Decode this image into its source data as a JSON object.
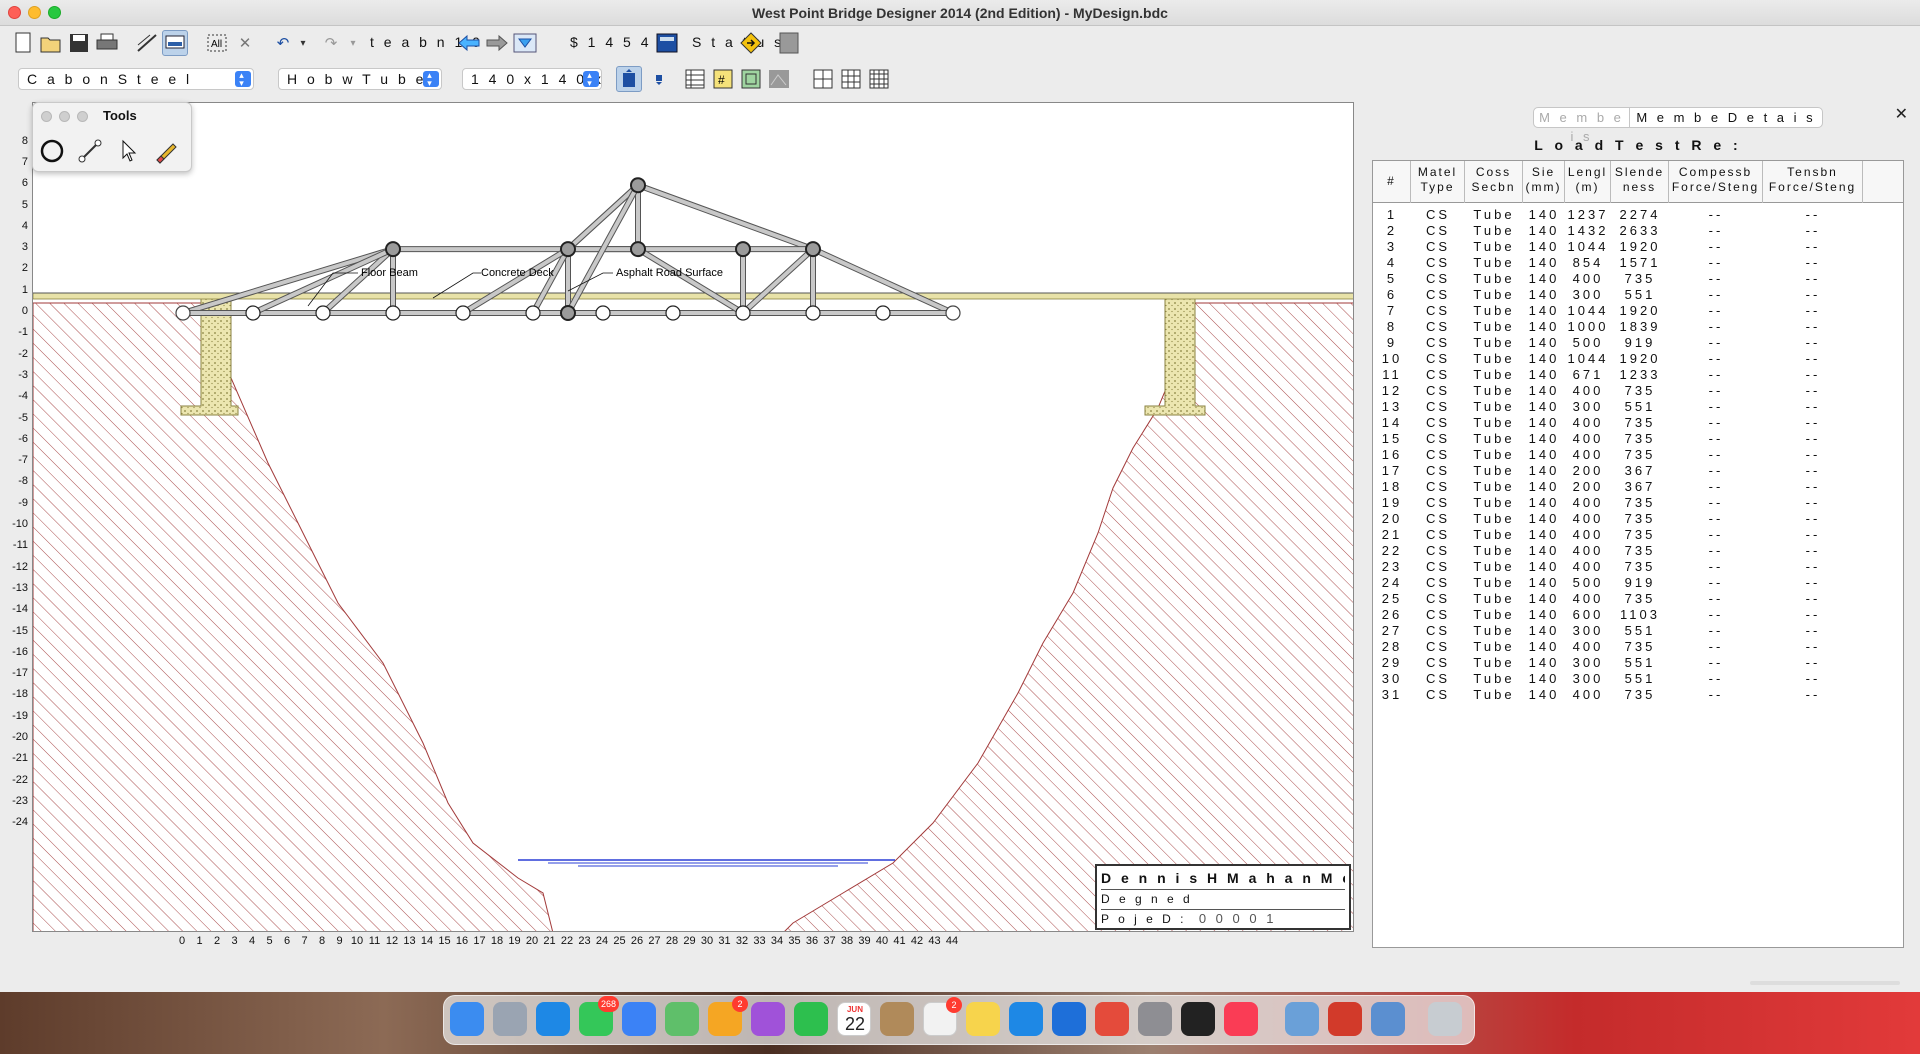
{
  "window": {
    "title": "West Point Bridge Designer 2014 (2nd Edition) - MyDesign.bdc"
  },
  "toolbar": {
    "design_iteration_label": "t e a b n  1 0",
    "cost_label": "$ 1 4 5 4 1",
    "status_label": "S t a t u s"
  },
  "selectors": {
    "material": "C a b o n S t e e l",
    "section": "H o b w T u b e",
    "size": "1 4 0 x 1 4 0 x"
  },
  "tools_palette": {
    "title": "Tools"
  },
  "drawing": {
    "labels": {
      "floor_beam": "Floor Beam",
      "concrete_deck": "Concrete Deck",
      "asphalt": "Asphalt Road Surface"
    },
    "y_ticks": [
      "8",
      "7",
      "6",
      "5",
      "4",
      "3",
      "2",
      "1",
      "0",
      "-1",
      "-2",
      "-3",
      "-4",
      "-5",
      "-6",
      "-7",
      "-8",
      "-9",
      "-10",
      "-11",
      "-12",
      "-13",
      "-14",
      "-15",
      "-16",
      "-17",
      "-18",
      "-19",
      "-20",
      "-21",
      "-22",
      "-23",
      "-24"
    ],
    "x_ticks": [
      "0",
      "1",
      "2",
      "3",
      "4",
      "5",
      "6",
      "7",
      "8",
      "9",
      "10",
      "11",
      "12",
      "13",
      "14",
      "15",
      "16",
      "17",
      "18",
      "19",
      "20",
      "21",
      "22",
      "23",
      "24",
      "25",
      "26",
      "27",
      "28",
      "29",
      "30",
      "31",
      "32",
      "33",
      "34",
      "35",
      "36",
      "37",
      "38",
      "39",
      "40",
      "41",
      "42",
      "43",
      "44"
    ]
  },
  "title_block": {
    "project": "D e n n i s  H M a h a n  M e m o i a  B i",
    "designed_by": "D e g n e d",
    "project_id_label": "P o j e D :",
    "project_id": "0 0 0 0 1"
  },
  "panel": {
    "tabs": [
      "M e m b e  i s",
      "M e m b e  D e t a i s"
    ],
    "title": "L o a d  T e s t  R e :",
    "headers": [
      "#",
      "Matel Type",
      "Coss Secbn",
      "Sie (mm)",
      "Lengl (m)",
      "Slende ness",
      "Compessb Force/Steng",
      "Tensbn Force/Steng"
    ],
    "rows": [
      [
        "1",
        "CS",
        "Tube",
        "140",
        "1237",
        "2274",
        "--",
        "--"
      ],
      [
        "2",
        "CS",
        "Tube",
        "140",
        "1432",
        "2633",
        "--",
        "--"
      ],
      [
        "3",
        "CS",
        "Tube",
        "140",
        "1044",
        "1920",
        "--",
        "--"
      ],
      [
        "4",
        "CS",
        "Tube",
        "140",
        "854",
        "1571",
        "--",
        "--"
      ],
      [
        "5",
        "CS",
        "Tube",
        "140",
        "400",
        "735",
        "--",
        "--"
      ],
      [
        "6",
        "CS",
        "Tube",
        "140",
        "300",
        "551",
        "--",
        "--"
      ],
      [
        "7",
        "CS",
        "Tube",
        "140",
        "1044",
        "1920",
        "--",
        "--"
      ],
      [
        "8",
        "CS",
        "Tube",
        "140",
        "1000",
        "1839",
        "--",
        "--"
      ],
      [
        "9",
        "CS",
        "Tube",
        "140",
        "500",
        "919",
        "--",
        "--"
      ],
      [
        "10",
        "CS",
        "Tube",
        "140",
        "1044",
        "1920",
        "--",
        "--"
      ],
      [
        "11",
        "CS",
        "Tube",
        "140",
        "671",
        "1233",
        "--",
        "--"
      ],
      [
        "12",
        "CS",
        "Tube",
        "140",
        "400",
        "735",
        "--",
        "--"
      ],
      [
        "13",
        "CS",
        "Tube",
        "140",
        "300",
        "551",
        "--",
        "--"
      ],
      [
        "14",
        "CS",
        "Tube",
        "140",
        "400",
        "735",
        "--",
        "--"
      ],
      [
        "15",
        "CS",
        "Tube",
        "140",
        "400",
        "735",
        "--",
        "--"
      ],
      [
        "16",
        "CS",
        "Tube",
        "140",
        "400",
        "735",
        "--",
        "--"
      ],
      [
        "17",
        "CS",
        "Tube",
        "140",
        "200",
        "367",
        "--",
        "--"
      ],
      [
        "18",
        "CS",
        "Tube",
        "140",
        "200",
        "367",
        "--",
        "--"
      ],
      [
        "19",
        "CS",
        "Tube",
        "140",
        "400",
        "735",
        "--",
        "--"
      ],
      [
        "20",
        "CS",
        "Tube",
        "140",
        "400",
        "735",
        "--",
        "--"
      ],
      [
        "21",
        "CS",
        "Tube",
        "140",
        "400",
        "735",
        "--",
        "--"
      ],
      [
        "22",
        "CS",
        "Tube",
        "140",
        "400",
        "735",
        "--",
        "--"
      ],
      [
        "23",
        "CS",
        "Tube",
        "140",
        "400",
        "735",
        "--",
        "--"
      ],
      [
        "24",
        "CS",
        "Tube",
        "140",
        "500",
        "919",
        "--",
        "--"
      ],
      [
        "25",
        "CS",
        "Tube",
        "140",
        "400",
        "735",
        "--",
        "--"
      ],
      [
        "26",
        "CS",
        "Tube",
        "140",
        "600",
        "1103",
        "--",
        "--"
      ],
      [
        "27",
        "CS",
        "Tube",
        "140",
        "300",
        "551",
        "--",
        "--"
      ],
      [
        "28",
        "CS",
        "Tube",
        "140",
        "400",
        "735",
        "--",
        "--"
      ],
      [
        "29",
        "CS",
        "Tube",
        "140",
        "300",
        "551",
        "--",
        "--"
      ],
      [
        "30",
        "CS",
        "Tube",
        "140",
        "300",
        "551",
        "--",
        "--"
      ],
      [
        "31",
        "CS",
        "Tube",
        "140",
        "400",
        "735",
        "--",
        "--"
      ]
    ]
  },
  "dock": {
    "badges": {
      "messages": "268",
      "photos": "2",
      "reminders": "2"
    },
    "calendar": {
      "month": "JUN",
      "day": "22"
    }
  },
  "colors": {
    "accent": "#3b82f6",
    "member": "#c8c8c8",
    "terrain": "#a23a3a",
    "abutment": "#e8e2a8",
    "water": "#2b3fd6"
  }
}
